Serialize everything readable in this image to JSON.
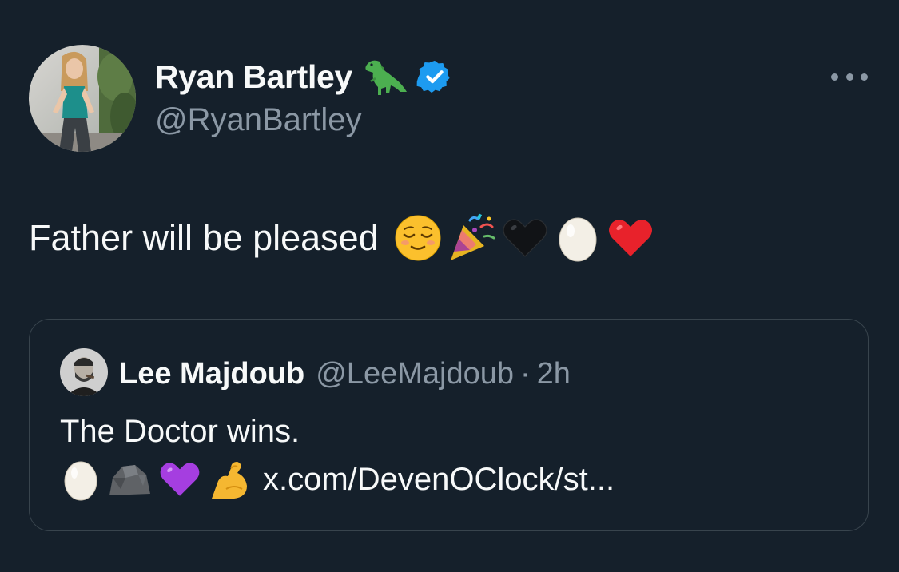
{
  "author": {
    "display_name": "Ryan Bartley",
    "name_emoji": "t-rex-icon",
    "verified": true,
    "handle": "@RyanBartley"
  },
  "more_menu_icon": "more-dots-icon",
  "tweet": {
    "text": "Father will be pleased",
    "emojis": [
      "relieved-face-icon",
      "party-popper-icon",
      "black-heart-icon",
      "egg-icon",
      "red-heart-icon"
    ]
  },
  "quoted_tweet": {
    "display_name": "Lee Majdoub",
    "handle": "@LeeMajdoub",
    "separator": "·",
    "time": "2h",
    "text": "The Doctor wins.",
    "emojis": [
      "egg-icon",
      "rock-icon",
      "purple-heart-icon",
      "flexed-biceps-icon"
    ],
    "link": "x.com/DevenOClock/st..."
  },
  "colors": {
    "background": "#15202b",
    "text_primary": "#f7f9f9",
    "text_secondary": "#8b98a5",
    "verified_badge": "#1d9bf0",
    "border": "#38444d"
  }
}
